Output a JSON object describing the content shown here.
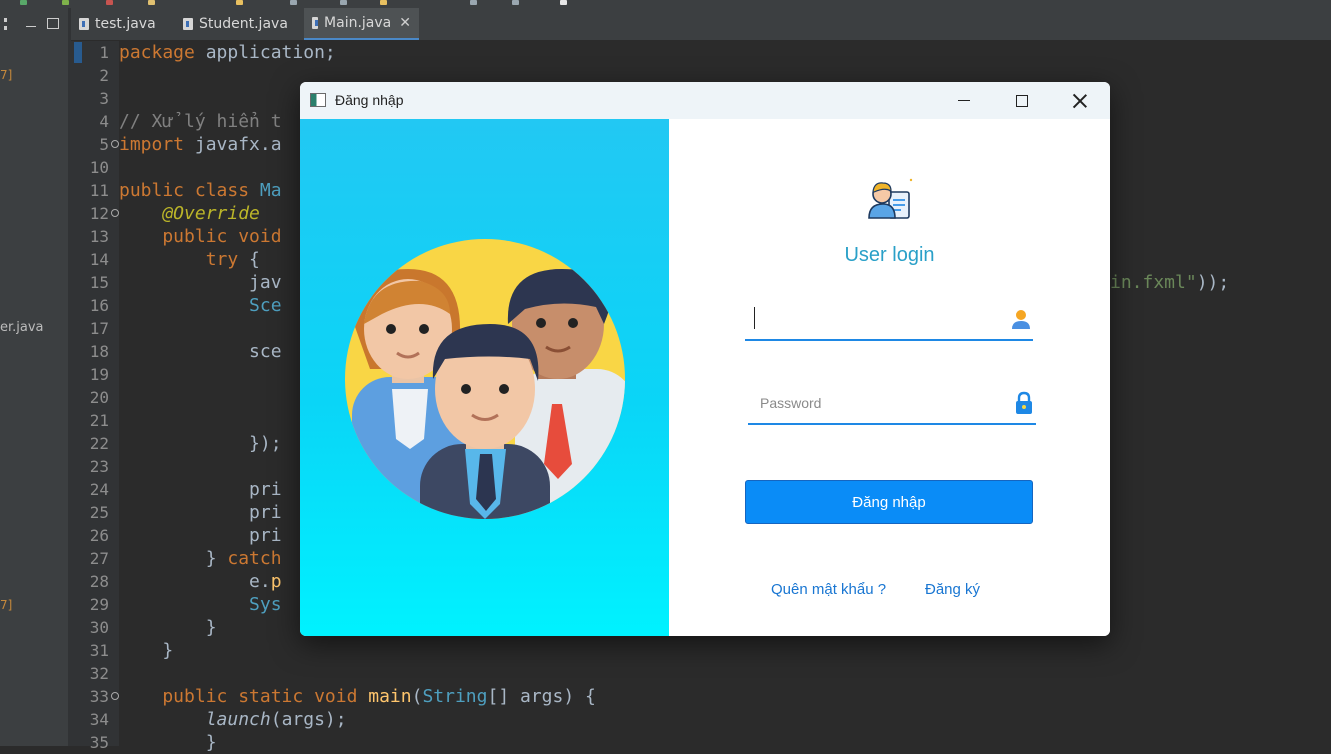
{
  "ide": {
    "tabs": [
      {
        "label": "test.java"
      },
      {
        "label": "Student.java"
      },
      {
        "label": "Main.java",
        "active": true
      }
    ],
    "tab_close": "✕",
    "left_panel": {
      "item_label": "er.java",
      "marker_1": "7]",
      "marker_2": "7]"
    },
    "line_numbers": [
      "1",
      "2",
      "3",
      "4",
      "5",
      "10",
      "11",
      "12",
      "13",
      "14",
      "15",
      "16",
      "17",
      "18",
      "19",
      "20",
      "21",
      "22",
      "23",
      "24",
      "25",
      "26",
      "27",
      "28",
      "29",
      "30",
      "31",
      "32",
      "33",
      "34",
      "35"
    ],
    "code": {
      "l1a": "package",
      "l1b": " application;",
      "l4": "// Xử lý hiển t",
      "l5a": "import",
      "l5b": " javafx.a",
      "l11a": "public class",
      "l11b": " Ma",
      "l12": "    @Override",
      "l13a": "    public voi",
      "l13b": "d",
      "l14a": "        try",
      "l14b": " {",
      "l15a": "            jav",
      "l15b": "in.fxml\"",
      "l15c": "));",
      "l16": "            Sce",
      "l18": "            sce",
      "l22": "            });",
      "l24": "            pri",
      "l25": "            pri",
      "l26": "            pri",
      "l27a": "        } ",
      "l27b": "catch",
      "l28a": "            e.",
      "l28b": "p",
      "l29": "            Sys",
      "l30": "        }",
      "l31": "    }",
      "l33a": "    public static void",
      "l33b": " main",
      "l33c": "(",
      "l33d": "String",
      "l33e": "[] ",
      "l33f": "args",
      "l33g": ") {",
      "l34a": "        ",
      "l34b": "launch",
      "l34c": "(args);",
      "l35": "        }"
    }
  },
  "dialog": {
    "title": "Đăng nhập",
    "header_text": "User login",
    "username_value": "",
    "password_placeholder": "Password",
    "login_button": "Đăng nhập",
    "forgot_link": "Quên mật khẩu ?",
    "register_link": "Đăng ký",
    "icons": {
      "app": "window-icon",
      "header": "user-login-icon",
      "username": "user-icon",
      "password": "lock-icon",
      "illustration": "team-people-illustration"
    }
  },
  "colors": {
    "gradient_top": "#22c8f3",
    "gradient_bottom": "#00f2ff",
    "accent": "#1e88e5",
    "button": "#0a8cf7",
    "title_text": "#2aa0c8"
  }
}
